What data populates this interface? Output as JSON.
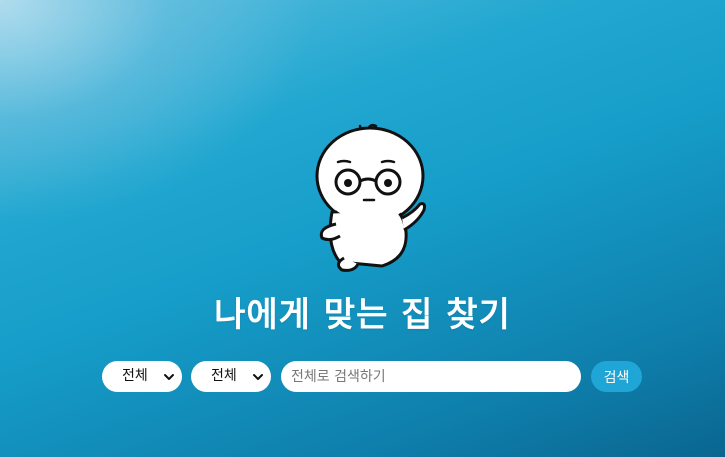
{
  "hero": {
    "title": "나에게 맞는 집 찾기",
    "mascot_icon": "glasses-character-icon"
  },
  "search": {
    "filter_1": {
      "selected": "전체"
    },
    "filter_2": {
      "selected": "전체"
    },
    "input_value": "",
    "placeholder": "전체로 검색하기",
    "button_label": "검색"
  },
  "colors": {
    "background_light": "#5fbfdf",
    "background_mid": "#169dc9",
    "background_dark": "#0a6690",
    "search_button": "#1fa5d6",
    "title_text": "#ffffff"
  }
}
